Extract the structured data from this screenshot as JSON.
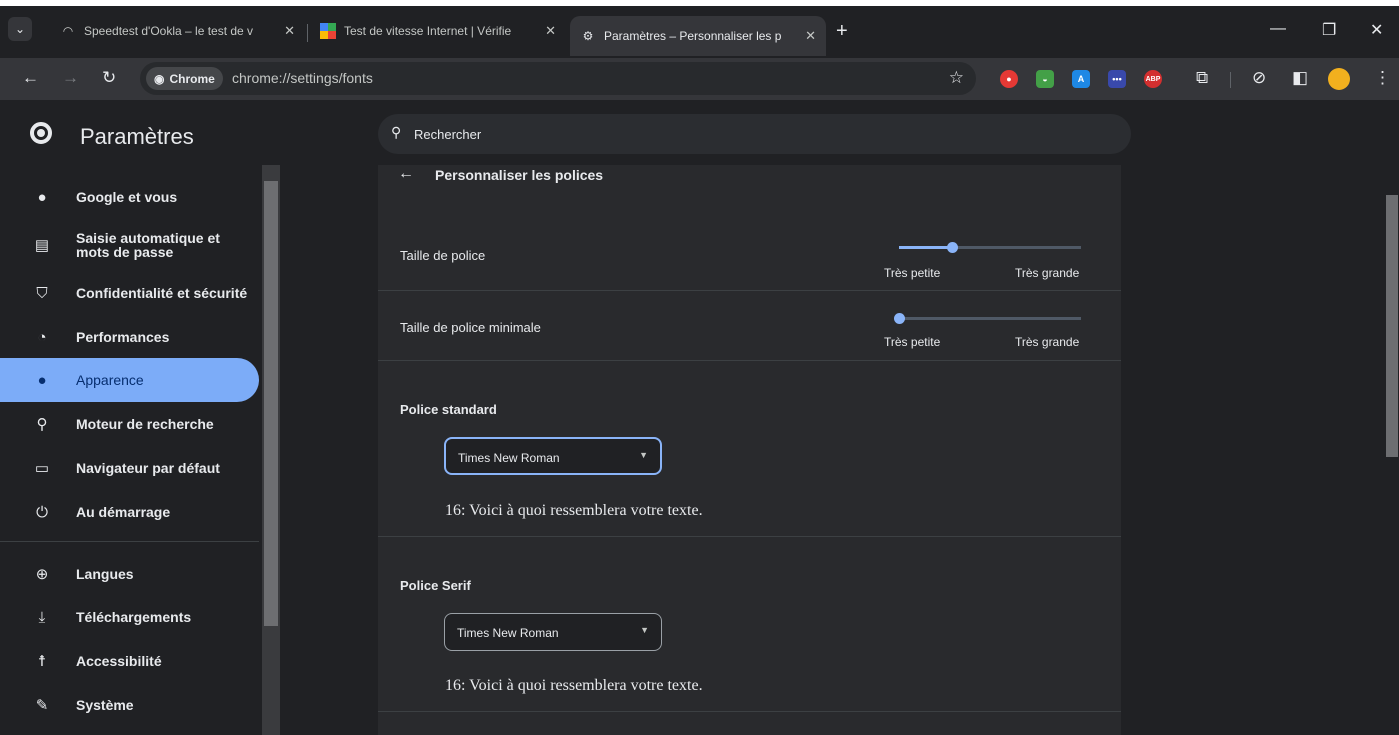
{
  "tabs": [
    {
      "title": "Speedtest d'Ookla – le test de v",
      "favicon": "speedtest-icon",
      "active": false
    },
    {
      "title": "Test de vitesse Internet | Vérifie",
      "favicon": "google-icon",
      "active": false
    },
    {
      "title": "Paramètres – Personnaliser les p",
      "favicon": "gear-icon",
      "active": true
    }
  ],
  "tab_close": "✕",
  "new_tab": "+",
  "window": {
    "minimize": "—",
    "restore": "❐",
    "close": "✕"
  },
  "toolbar": {
    "chip_label": "Chrome",
    "url": "chrome://settings/fonts",
    "extensions": [
      {
        "name": "stop-extension-icon",
        "color": "#e53935",
        "text": "●"
      },
      {
        "name": "picture-extension-icon",
        "color": "#43a047",
        "text": "◒"
      },
      {
        "name": "reader-extension-icon",
        "color": "#1e88e5",
        "text": "A"
      },
      {
        "name": "dots-extension-icon",
        "color": "#3949ab",
        "text": "•••"
      },
      {
        "name": "adblock-plus-icon",
        "color": "#d32f2f",
        "text": "ABP"
      }
    ]
  },
  "header": {
    "title": "Paramètres",
    "search_placeholder": "Rechercher"
  },
  "sidebar": {
    "items": [
      {
        "label": "Google et vous",
        "icon": "person-icon",
        "glyph": "👤"
      },
      {
        "label": "Saisie automatique et mots de passe",
        "icon": "clipboard-icon",
        "glyph": "📋"
      },
      {
        "label": "Confidentialité et sécurité",
        "icon": "shield-icon",
        "glyph": "🛡"
      },
      {
        "label": "Performances",
        "icon": "gauge-icon",
        "glyph": "◔"
      },
      {
        "label": "Apparence",
        "icon": "palette-icon",
        "glyph": "🎨",
        "active": true
      },
      {
        "label": "Moteur de recherche",
        "icon": "search-icon",
        "glyph": "⚲"
      },
      {
        "label": "Navigateur par défaut",
        "icon": "browser-icon",
        "glyph": "▭"
      },
      {
        "label": "Au démarrage",
        "icon": "power-icon",
        "glyph": "⏻"
      },
      {
        "label": "Langues",
        "icon": "globe-icon",
        "glyph": "🌐"
      },
      {
        "label": "Téléchargements",
        "icon": "download-icon",
        "glyph": "⤓"
      },
      {
        "label": "Accessibilité",
        "icon": "accessibility-icon",
        "glyph": "♿"
      },
      {
        "label": "Système",
        "icon": "wrench-icon",
        "glyph": "🔧"
      }
    ]
  },
  "page": {
    "title": "Personnaliser les polices",
    "font_size": {
      "label": "Taille de police",
      "min": "Très petite",
      "max": "Très grande",
      "level": 0.29
    },
    "min_font_size": {
      "label": "Taille de police minimale",
      "min": "Très petite",
      "max": "Très grande",
      "level": 0.0
    },
    "standard": {
      "label": "Police standard",
      "value": "Times New Roman",
      "sample": "16: Voici à quoi ressemblera votre texte."
    },
    "serif": {
      "label": "Police Serif",
      "value": "Times New Roman",
      "sample": "16: Voici à quoi ressemblera votre texte."
    }
  }
}
